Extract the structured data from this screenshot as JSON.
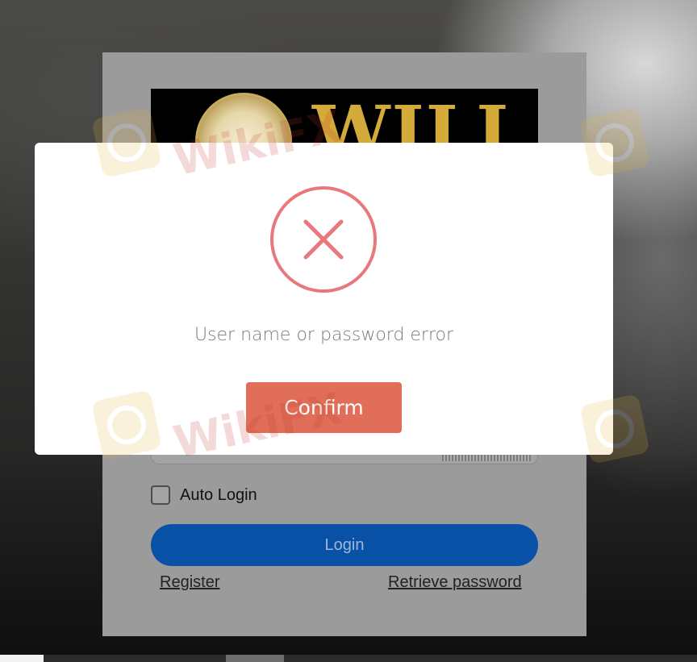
{
  "login_form": {
    "logo_text": "WILL",
    "auto_login_label": "Auto Login",
    "auto_login_checked": false,
    "login_button_label": "Login",
    "register_link": "Register",
    "retrieve_password_link": "Retrieve password"
  },
  "error_dialog": {
    "icon": "error-x-circle-icon",
    "message": "User name or password error",
    "confirm_button_label": "Confirm"
  },
  "watermark": {
    "text": "WikiFX"
  },
  "colors": {
    "error_red": "#e8787b",
    "confirm_orange": "#e16e58",
    "login_blue": "#0851a7"
  }
}
